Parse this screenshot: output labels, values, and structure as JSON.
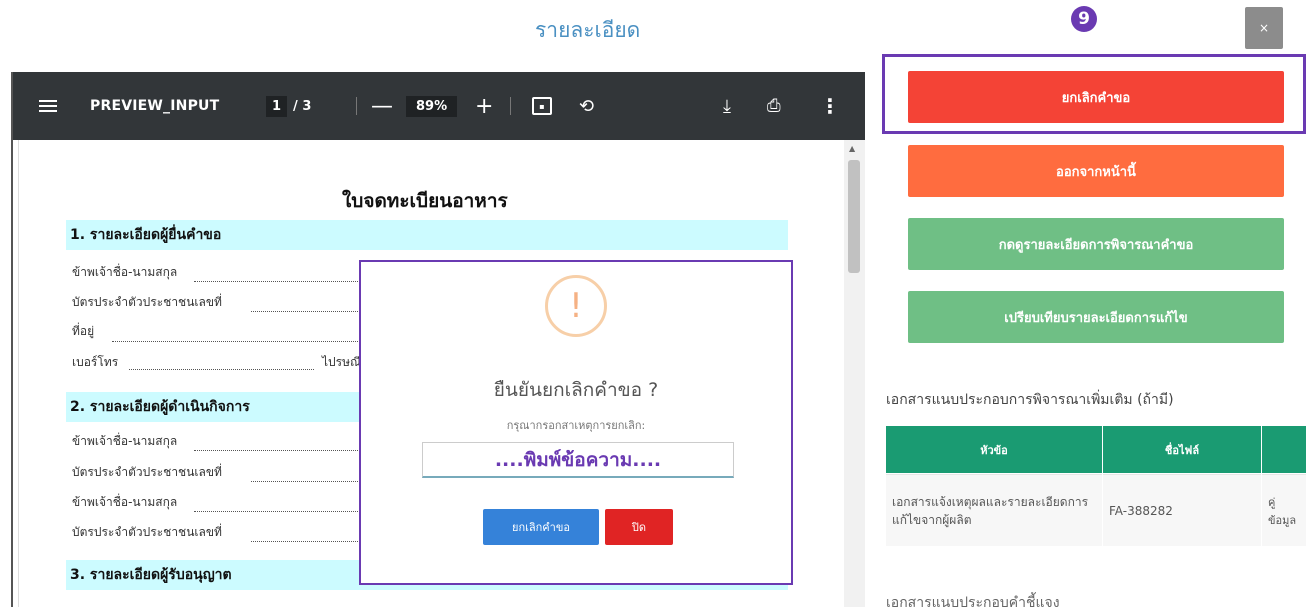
{
  "header": {
    "title": "รายละเอียด",
    "step_number": "9",
    "close_label": "×"
  },
  "pdf": {
    "toolbar": {
      "doc_name": "PREVIEW_INPUT",
      "page_current": "1",
      "page_total": "/ 3",
      "zoom": "89%",
      "zoom_out": "—",
      "zoom_in": "+"
    },
    "doc_title": "ใบจดทะเบียนอาหาร",
    "sections": [
      {
        "heading": "1. รายละเอียดผู้ยื่นคำขอ"
      },
      {
        "heading": "2. รายละเอียดผู้ดำเนินกิจการ"
      },
      {
        "heading": "3. รายละเอียดผู้รับอนุญาต"
      }
    ],
    "fields": {
      "s1_name": "ข้าพเจ้าชื่อ-นามสกุล",
      "s1_id": "บัตรประจำตัวประชาชนเลขที่",
      "s1_addr": "ที่อยู่",
      "s1_phone": "เบอร์โทร",
      "s1_email": "ไปรษณี",
      "s2_name": "ข้าพเจ้าชื่อ-นามสกุล",
      "s2_id": "บัตรประจำตัวประชาชนเลขที่",
      "s2_name2": "ข้าพเจ้าชื่อ-นามสกุล",
      "s2_id2": "บัตรประจำตัวประชาชนเลขที่"
    }
  },
  "dialog": {
    "icon": "!",
    "title": "ยืนยันยกเลิกคำขอ ?",
    "label": "กรุณากรอกสาเหตุการยกเลิก:",
    "input_placeholder": "....พิมพ์ข้อความ....",
    "confirm_label": "ยกเลิกคำขอ",
    "close_label": "ปิด"
  },
  "actions": {
    "cancel_request": "ยกเลิกคำขอ",
    "leave_page": "ออกจากหน้านี้",
    "view_review": "กดดูรายละเอียดการพิจารณาคำขอ",
    "compare": "เปรียบเทียบรายละเอียดการแก้ไข"
  },
  "attachments": {
    "title": "เอกสารแนบประกอบการพิจารณาเพิ่มเติม (ถ้ามี)",
    "columns": [
      "หัวข้อ",
      "ชื่อไฟล์",
      ""
    ],
    "rows": [
      {
        "topic": "เอกสารแจ้งเหตุผลและรายละเอียดการแก้ไขจากผู้ผลิต",
        "file": "FA-388282",
        "extra": "คู่\nข้อมูล"
      }
    ],
    "next_title": "เอกสารแนบประกอบคำชี้แจง"
  },
  "colors": {
    "accent": "#6a3ab2",
    "red": "#f44336",
    "orange": "#ff6c3f",
    "green": "#6fbf85",
    "table_header": "#1a9b72"
  }
}
